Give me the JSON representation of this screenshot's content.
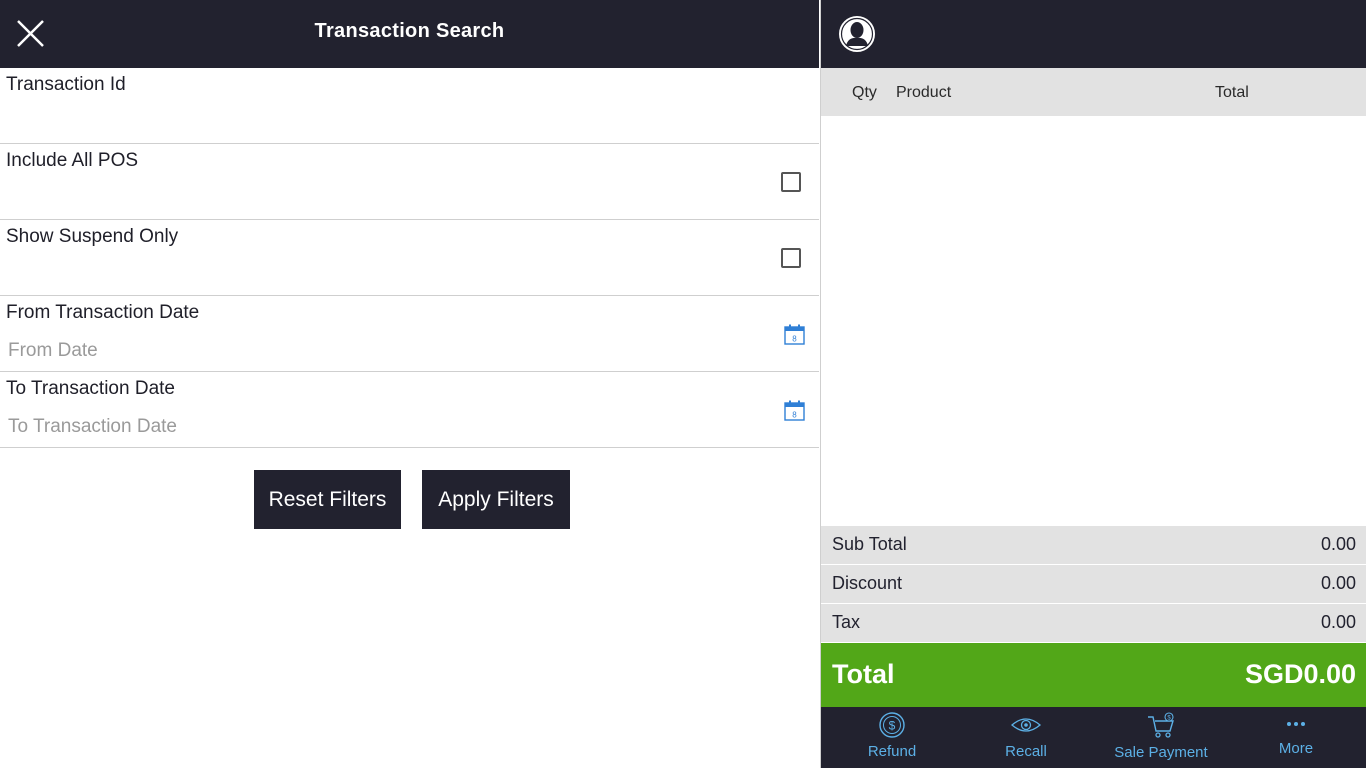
{
  "header": {
    "title": "Transaction Search"
  },
  "filters": {
    "transaction_id": {
      "label": "Transaction Id"
    },
    "include_all_pos": {
      "label": "Include All POS"
    },
    "show_suspend_only": {
      "label": "Show Suspend Only"
    },
    "from_date": {
      "label": "From Transaction Date",
      "placeholder": "From Date"
    },
    "to_date": {
      "label": "To Transaction Date",
      "placeholder": "To Transaction Date"
    },
    "calendar_day": "8"
  },
  "buttons": {
    "reset": "Reset Filters",
    "apply": "Apply Filters"
  },
  "cart": {
    "columns": {
      "qty": "Qty",
      "product": "Product",
      "total": "Total"
    }
  },
  "summary": {
    "sub_total_label": "Sub Total",
    "sub_total": "0.00",
    "discount_label": "Discount",
    "discount": "0.00",
    "tax_label": "Tax",
    "tax": "0.00",
    "total_label": "Total",
    "total": "SGD0.00"
  },
  "nav": {
    "refund": "Refund",
    "recall": "Recall",
    "sale_payment": "Sale Payment",
    "more": "More"
  },
  "colors": {
    "dark": "#22222f",
    "accent_green": "#52a718",
    "nav_blue": "#5cb0e6",
    "calendar_blue": "#2f7fd6"
  }
}
